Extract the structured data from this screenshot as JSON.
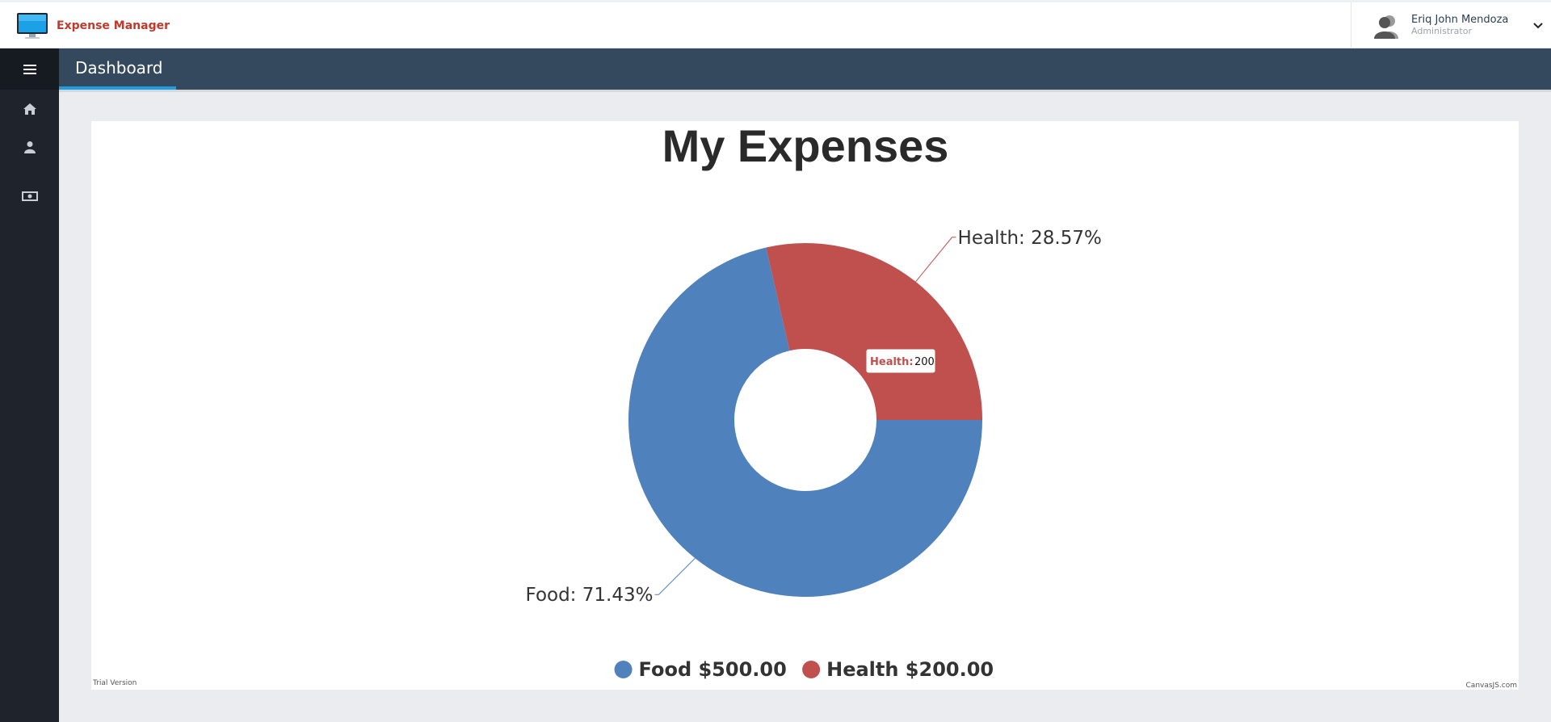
{
  "app": {
    "name": "Expense Manager",
    "brand_color": "#c0392b"
  },
  "user": {
    "name": "Eriq John Mendoza",
    "role": "Administrator"
  },
  "header": {
    "title": "Dashboard"
  },
  "sidebar": {
    "items": [
      {
        "icon": "menu-icon"
      },
      {
        "icon": "home-icon"
      },
      {
        "icon": "user-icon"
      },
      {
        "icon": "money-icon"
      }
    ]
  },
  "chart_data": {
    "type": "doughnut",
    "title": "My Expenses",
    "categories": [
      "Food",
      "Health"
    ],
    "values": [
      500,
      200
    ],
    "percent_labels": [
      "Food: 71.43%",
      "Health: 28.57%"
    ],
    "legend": [
      "Food $500.00",
      "Health $200.00"
    ],
    "legend_placement": "bottom",
    "colors": [
      "#4f81bc",
      "#c0504e"
    ],
    "tooltip": {
      "label": "Health:",
      "value": "200"
    }
  },
  "footer": {
    "trial": "Trial Version",
    "credit": "CanvasJS.com"
  }
}
